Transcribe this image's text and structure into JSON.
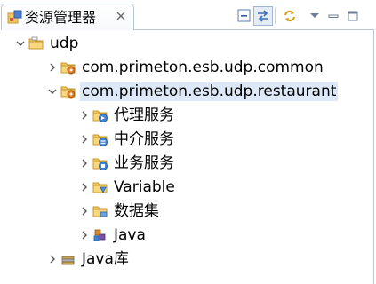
{
  "view": {
    "title": "资源管理器",
    "icon": "explorer-view-icon",
    "close_icon": "close-icon",
    "toolbar": [
      {
        "name": "collapse-all-icon"
      },
      {
        "name": "link-with-editor-icon",
        "active": true
      },
      {
        "name": "sync-icon"
      },
      {
        "name": "view-menu-icon"
      },
      {
        "name": "minimize-icon"
      },
      {
        "name": "maximize-icon"
      }
    ]
  },
  "tree": [
    {
      "label": "udp",
      "level": 0,
      "expanded": true,
      "icon": "project-folder-icon"
    },
    {
      "label": "com.primeton.esb.udp.common",
      "level": 1,
      "expanded": false,
      "icon": "module-icon"
    },
    {
      "label": "com.primeton.esb.udp.restaurant",
      "level": 1,
      "expanded": true,
      "selected": true,
      "icon": "module-icon"
    },
    {
      "label": "代理服务",
      "level": 2,
      "expanded": false,
      "icon": "proxy-service-folder-icon"
    },
    {
      "label": "中介服务",
      "level": 2,
      "expanded": false,
      "icon": "mediation-service-folder-icon"
    },
    {
      "label": "业务服务",
      "level": 2,
      "expanded": false,
      "icon": "business-service-folder-icon"
    },
    {
      "label": "Variable",
      "level": 2,
      "expanded": false,
      "icon": "variable-folder-icon"
    },
    {
      "label": "数据集",
      "level": 2,
      "expanded": false,
      "icon": "dataset-folder-icon"
    },
    {
      "label": "Java",
      "level": 2,
      "expanded": false,
      "icon": "java-icon"
    },
    {
      "label": "Java库",
      "level": 1,
      "expanded": false,
      "icon": "java-library-icon"
    }
  ],
  "colors": {
    "selection": "#dde9f8",
    "border": "#b9c7d9",
    "folder": "#f2c55c",
    "folder_edge": "#c99a2e"
  }
}
